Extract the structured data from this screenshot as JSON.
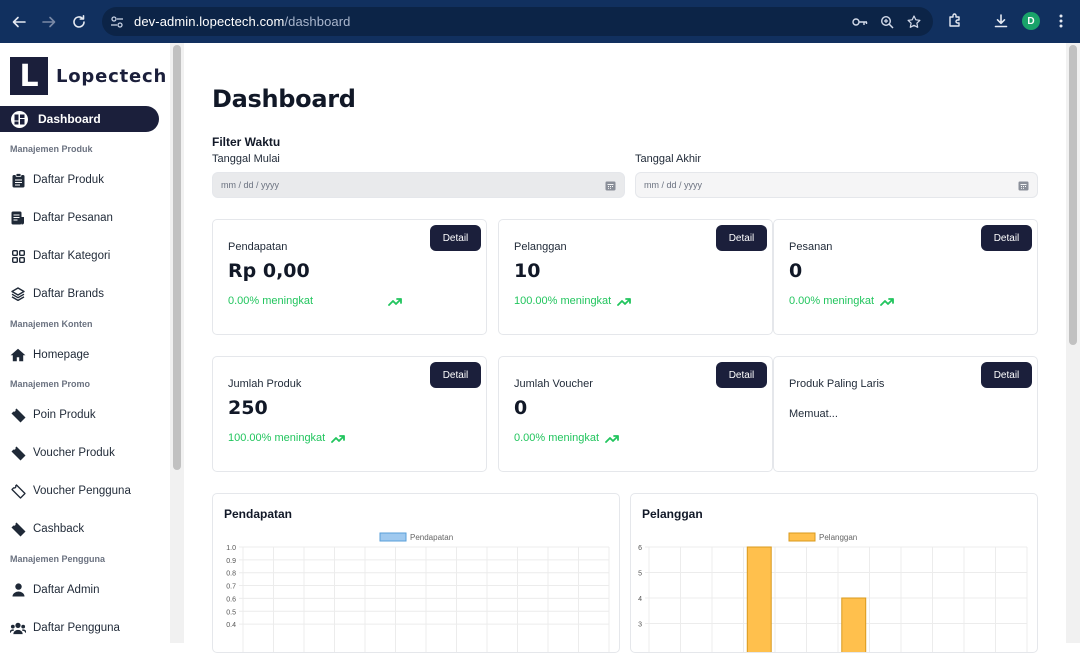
{
  "browser": {
    "url_host": "dev-admin.lopectech.com",
    "url_path": "/dashboard",
    "profile_initial": "D",
    "icons": [
      "back-icon",
      "forward-icon",
      "reload-icon",
      "site-settings-icon",
      "password-key-icon",
      "zoom-icon",
      "bookmark-star-icon",
      "extensions-icon",
      "download-icon",
      "menu-icon"
    ]
  },
  "sidebar": {
    "logo_letter": "L",
    "brand": "Lopectech",
    "active": {
      "label": "Dashboard",
      "icon": "dashboard-icon"
    },
    "sections": [
      {
        "title": "Manajemen Produk",
        "items": [
          {
            "label": "Daftar Produk",
            "icon": "clipboard-list-icon"
          },
          {
            "label": "Daftar Pesanan",
            "icon": "receipt-icon"
          },
          {
            "label": "Daftar Kategori",
            "icon": "grid-icon"
          },
          {
            "label": "Daftar Brands",
            "icon": "layers-icon"
          }
        ]
      },
      {
        "title": "Manajemen Konten",
        "items": [
          {
            "label": "Homepage",
            "icon": "home-icon"
          }
        ]
      },
      {
        "title": "Manajemen Promo",
        "items": [
          {
            "label": "Poin Produk",
            "icon": "ticket-icon"
          },
          {
            "label": "Voucher Produk",
            "icon": "ticket-icon"
          },
          {
            "label": "Voucher Pengguna",
            "icon": "ticket-outline-icon"
          },
          {
            "label": "Cashback",
            "icon": "ticket-icon"
          }
        ]
      },
      {
        "title": "Manajemen Pengguna",
        "items": [
          {
            "label": "Daftar Admin",
            "icon": "user-icon"
          },
          {
            "label": "Daftar Pengguna",
            "icon": "users-icon"
          }
        ]
      }
    ]
  },
  "page": {
    "title": "Dashboard",
    "filter": {
      "title": "Filter Waktu",
      "start_label": "Tanggal Mulai",
      "end_label": "Tanggal Akhir",
      "start_placeholder": "mm / dd / yyyy",
      "end_placeholder": "mm / dd / yyyy"
    },
    "detail_label": "Detail",
    "cards": [
      {
        "label": "Pendapatan",
        "value": "Rp 0,00",
        "trend": "0.00% meningkat"
      },
      {
        "label": "Pelanggan",
        "value": "10",
        "trend": "100.00% meningkat"
      },
      {
        "label": "Pesanan",
        "value": "0",
        "trend": "0.00% meningkat"
      },
      {
        "label": "Jumlah Produk",
        "value": "250",
        "trend": "100.00% meningkat"
      },
      {
        "label": "Jumlah Voucher",
        "value": "0",
        "trend": "0.00% meningkat"
      },
      {
        "label": "Produk Paling Laris",
        "value": "",
        "loading": "Memuat..."
      }
    ]
  },
  "chart_data": [
    {
      "type": "bar",
      "title": "Pendapatan",
      "series": [
        {
          "name": "Pendapatan",
          "values": [],
          "color": "#9fc9ef"
        }
      ],
      "visible_y_ticks": [
        1.0,
        0.9,
        0.8,
        0.7,
        0.6,
        0.5,
        0.4
      ],
      "ylim": [
        0,
        1.0
      ],
      "grid": true,
      "legend": "top-center"
    },
    {
      "type": "bar",
      "title": "Pelanggan",
      "series": [
        {
          "name": "Pelanggan",
          "values": [
            0,
            0,
            0,
            6,
            0,
            0,
            4,
            0,
            0,
            0,
            0,
            0
          ],
          "color": "#ffc04d"
        }
      ],
      "visible_y_ticks": [
        6,
        5,
        4,
        3
      ],
      "ylim": [
        0,
        6
      ],
      "grid": true,
      "legend": "top-center"
    }
  ]
}
